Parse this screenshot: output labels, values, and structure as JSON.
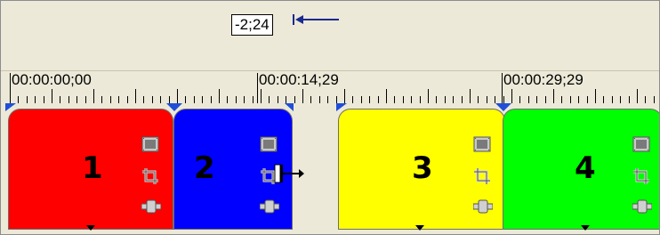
{
  "offset_display": {
    "value": "-2;24",
    "arrow_icon": "left-arrow-icon"
  },
  "ruler": {
    "timecodes": [
      "00:00:00;00",
      "00:00:14;29",
      "00:00:29;29"
    ]
  },
  "clips": [
    {
      "label": "1",
      "color": "#ff0000"
    },
    {
      "label": "2",
      "color": "#0000ff"
    },
    {
      "label": "3",
      "color": "#ffff00"
    },
    {
      "label": "4",
      "color": "#00ff00"
    }
  ],
  "clip_icons": [
    "film-icon",
    "crop-icon",
    "effects-plug-icon"
  ],
  "colors": {
    "marker": "#1f4fd8",
    "background": "#ece9d8",
    "arrow": "#1b2a8f"
  }
}
